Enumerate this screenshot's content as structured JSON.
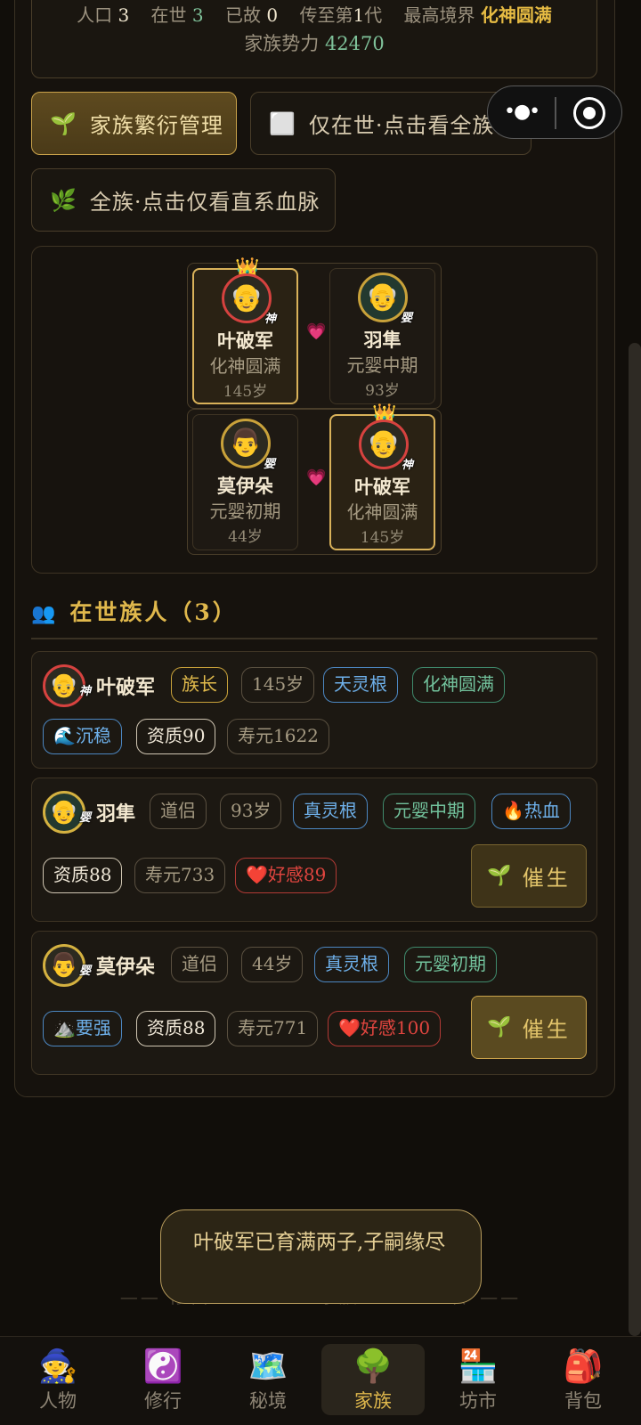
{
  "stats": {
    "population_label": "人口",
    "population": "3",
    "alive_label": "在世",
    "alive": "3",
    "dead_label": "已故",
    "dead": "0",
    "generation_prefix": "传至第",
    "generation": "1",
    "generation_suffix": "代",
    "top_realm_label": "最高境界",
    "top_realm": "化神圆满",
    "power_label": "家族势力",
    "power": "42470"
  },
  "buttons": {
    "manage": {
      "icon": "🌱",
      "label": "家族繁衍管理"
    },
    "alive_only": {
      "icon": "⬜",
      "label": "仅在世·点击看全族谱"
    },
    "whole_clan": {
      "icon": "🌿",
      "label": "全族·点击仅看直系血脉"
    }
  },
  "tree": {
    "pairs": [
      {
        "left": {
          "name": "叶破军",
          "realm": "化神圆满",
          "age": "145岁",
          "badge": "神",
          "avatar": "👴",
          "crown": "👑"
        },
        "right": {
          "name": "羽隼",
          "realm": "元婴中期",
          "age": "93岁",
          "badge": "婴",
          "avatar": "👴"
        },
        "heart": "💗"
      },
      {
        "left": {
          "name": "莫伊朵",
          "realm": "元婴初期",
          "age": "44岁",
          "badge": "婴",
          "avatar": "👨"
        },
        "right": {
          "name": "叶破军",
          "realm": "化神圆满",
          "age": "145岁",
          "badge": "神",
          "avatar": "👴",
          "crown": "👑"
        },
        "heart": "💗"
      }
    ]
  },
  "section": {
    "icon": "👥",
    "title": "在世族人（3）"
  },
  "members": [
    {
      "name": "叶破军",
      "avatar": "👴",
      "badge": "神",
      "tags": [
        "族长",
        "145岁",
        "天灵根",
        "化神圆满",
        "🌊沉稳",
        "资质90",
        "寿元1622"
      ]
    },
    {
      "name": "羽隼",
      "avatar": "👴",
      "badge": "婴",
      "tags": [
        "道侣",
        "93岁",
        "真灵根",
        "元婴中期",
        "🔥热血",
        "资质88",
        "寿元733",
        "❤️好感89"
      ],
      "action": {
        "icon": "🌱",
        "label": "催生"
      }
    },
    {
      "name": "莫伊朵",
      "avatar": "👨",
      "badge": "婴",
      "tags": [
        "道侣",
        "44岁",
        "真灵根",
        "元婴初期",
        "⛰️要强",
        "资质88",
        "寿元771",
        "❤️好感100"
      ],
      "action": {
        "icon": "🌱",
        "label": "催生"
      }
    }
  ],
  "footer_text": "—— 修仙 · · · · · · 家族 · · · · · 传 ——",
  "toast": "叶破军已育满两子,子嗣缘尽",
  "nav": [
    {
      "icon": "🧙",
      "label": "人物"
    },
    {
      "icon": "☯️",
      "label": "修行"
    },
    {
      "icon": "🗺️",
      "label": "秘境"
    },
    {
      "icon": "🌳",
      "label": "家族",
      "active": true
    },
    {
      "icon": "🏪",
      "label": "坊市"
    },
    {
      "icon": "🎒",
      "label": "背包"
    }
  ],
  "capsule": {
    "more_icon": "more-dots-icon",
    "close_icon": "target-icon"
  }
}
